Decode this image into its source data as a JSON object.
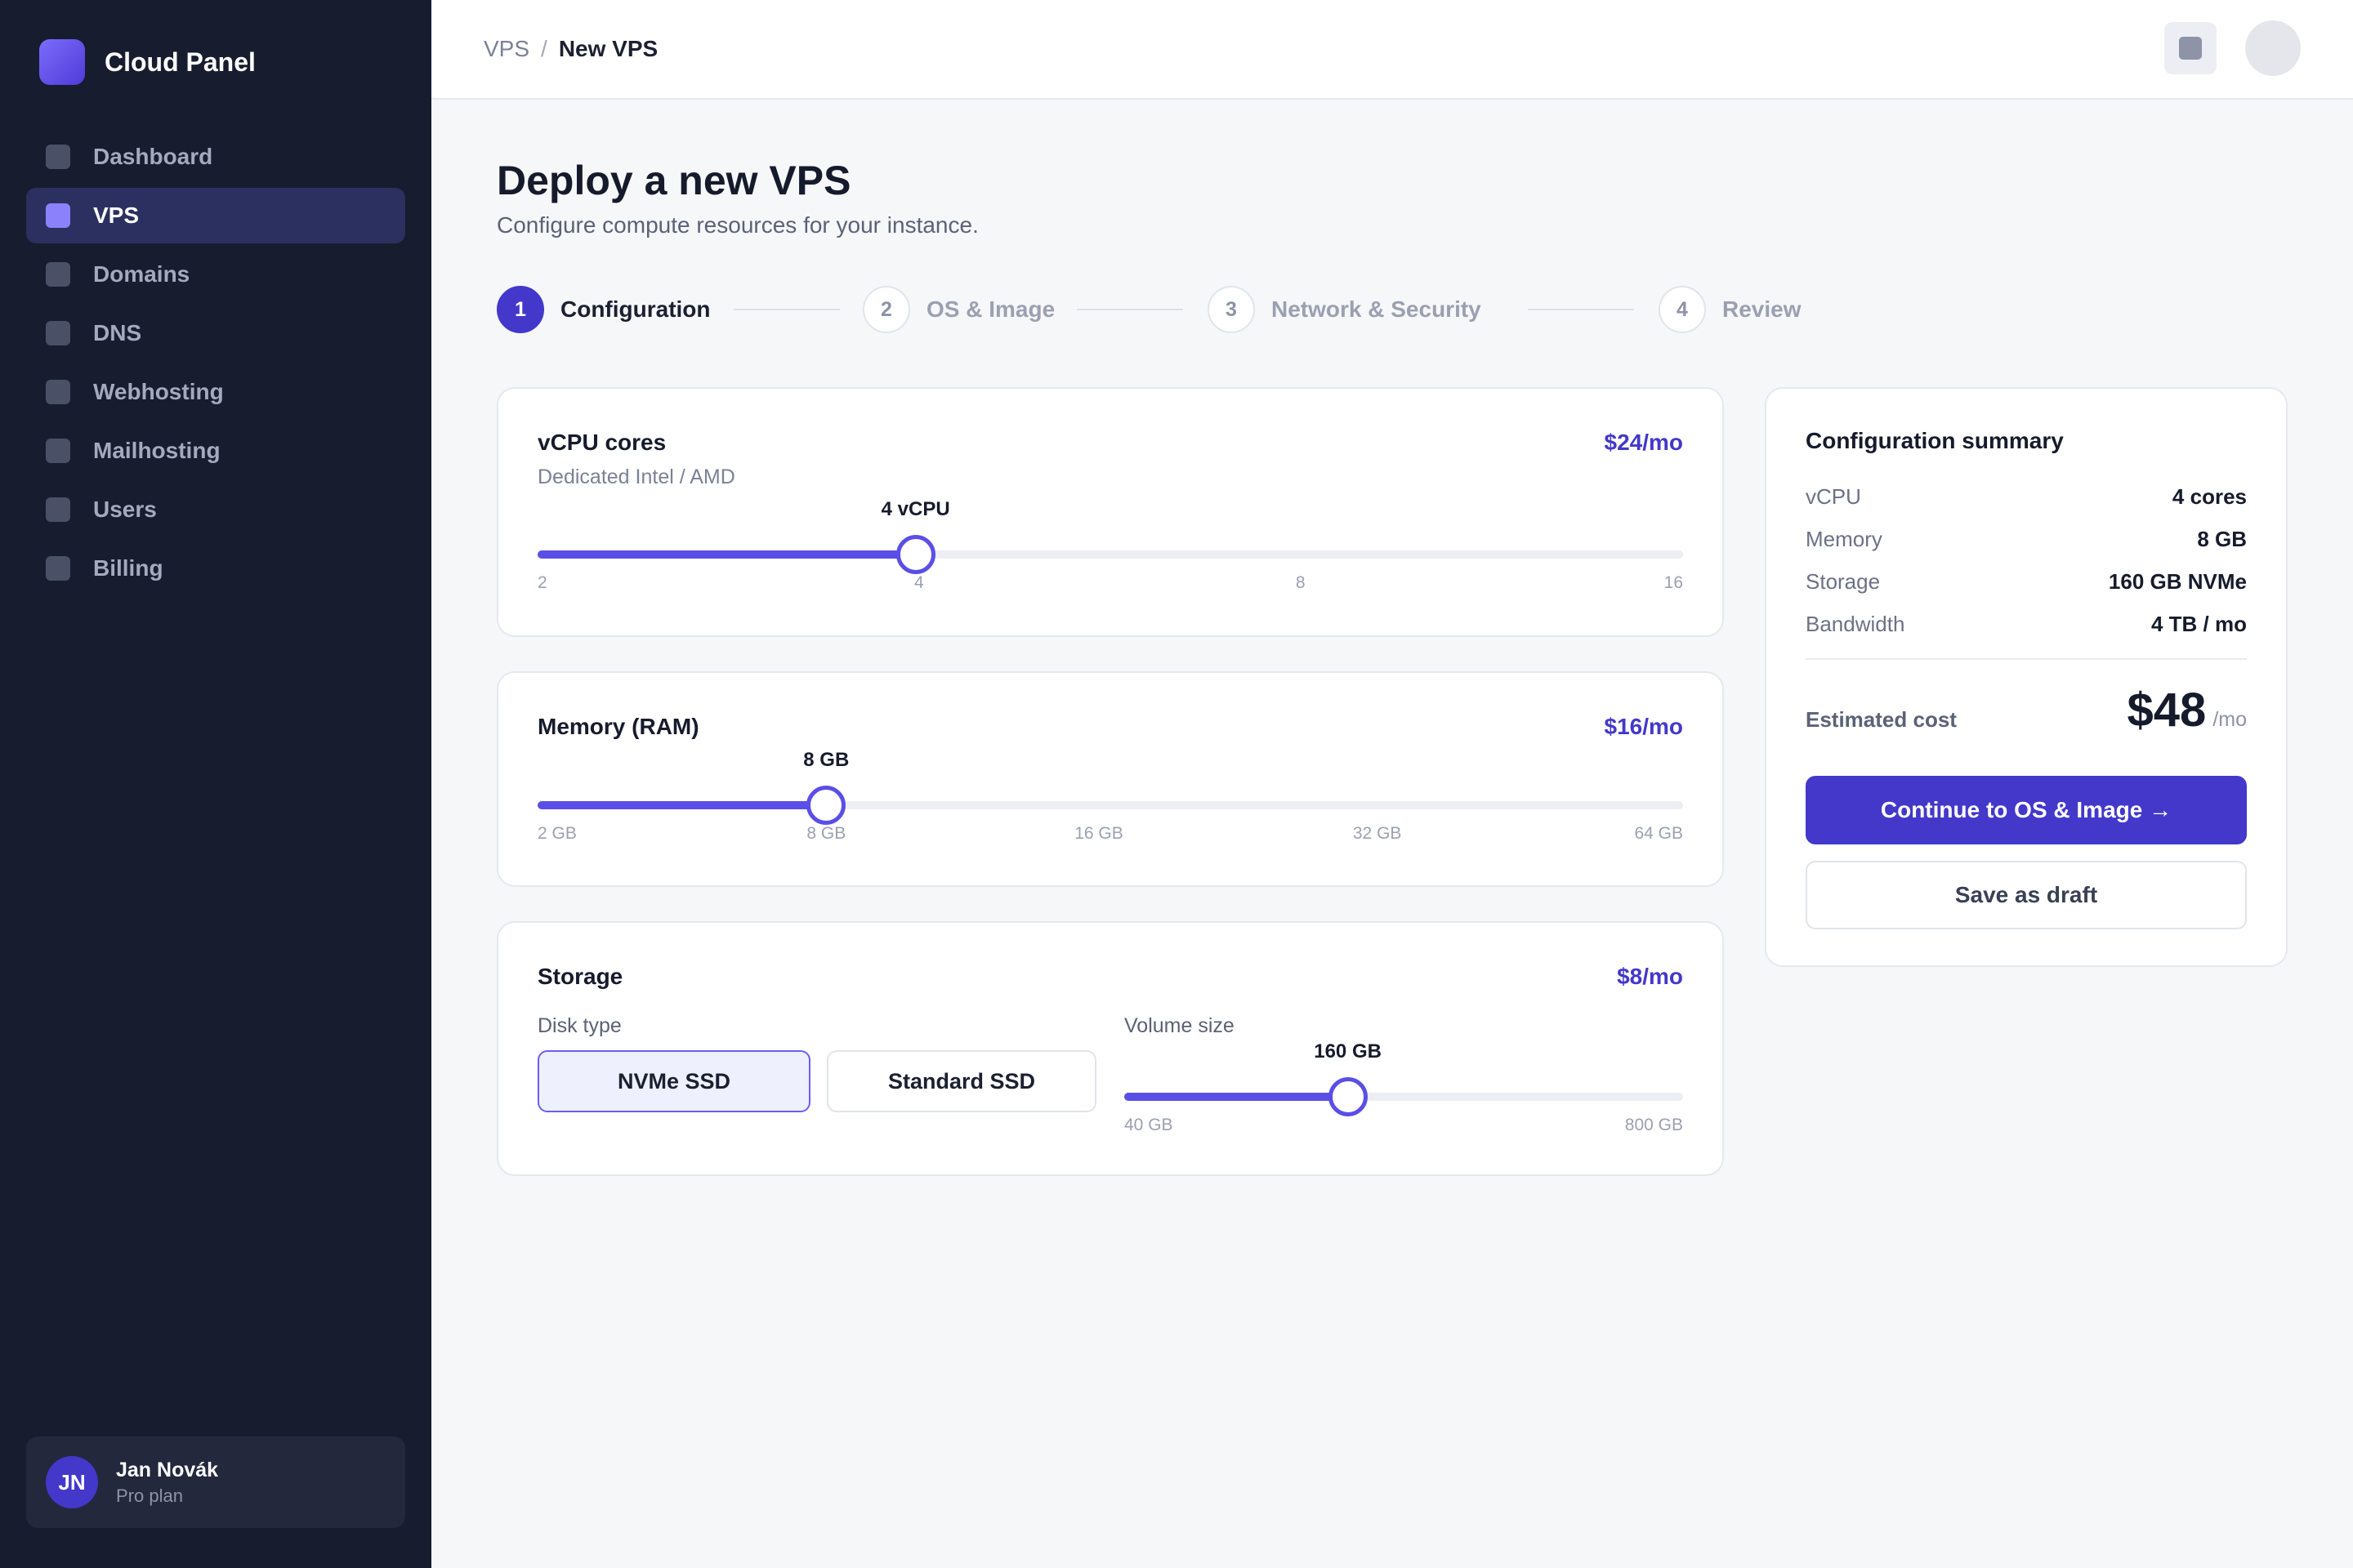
{
  "app": {
    "name": "Cloud Panel"
  },
  "sidebar": {
    "items": [
      {
        "label": "Dashboard",
        "active": false
      },
      {
        "label": "VPS",
        "active": true
      },
      {
        "label": "Domains",
        "active": false
      },
      {
        "label": "DNS",
        "active": false
      },
      {
        "label": "Webhosting",
        "active": false
      },
      {
        "label": "Mailhosting",
        "active": false
      },
      {
        "label": "Users",
        "active": false
      },
      {
        "label": "Billing",
        "active": false
      }
    ],
    "user": {
      "initials": "JN",
      "name": "Jan Novák",
      "plan": "Pro plan"
    }
  },
  "header": {
    "breadcrumb": {
      "root": "VPS",
      "separator": "/",
      "current": "New VPS"
    }
  },
  "page": {
    "title": "Deploy a new VPS",
    "subtitle": "Configure compute resources for your instance."
  },
  "steps": [
    {
      "num": "1",
      "label": "Configuration",
      "active": true
    },
    {
      "num": "2",
      "label": "OS & Image",
      "active": false
    },
    {
      "num": "3",
      "label": "Network & Security",
      "active": false
    },
    {
      "num": "4",
      "label": "Review",
      "active": false
    }
  ],
  "vcpu": {
    "title": "vCPU cores",
    "subtitle": "Dedicated Intel / AMD",
    "price": "$24/mo",
    "value_label": "4 vCPU",
    "ticks": [
      "2",
      "4",
      "8",
      "16"
    ],
    "selected_index": 1
  },
  "memory": {
    "title": "Memory (RAM)",
    "price": "$16/mo",
    "value_label": "8 GB",
    "ticks": [
      "2 GB",
      "8 GB",
      "16 GB",
      "32 GB",
      "64 GB"
    ],
    "selected_index": 1
  },
  "storage": {
    "title": "Storage",
    "price": "$8/mo",
    "disk_type_label": "Disk type",
    "disk_options": [
      "NVMe SSD",
      "Standard SSD"
    ],
    "selected_disk": "NVMe SSD",
    "volume_label": "Volume size",
    "volume_value_label": "160 GB",
    "volume_min": "40 GB",
    "volume_max": "800 GB",
    "volume_fill_fraction": 0.4
  },
  "summary": {
    "title": "Configuration summary",
    "rows": [
      {
        "key": "vCPU",
        "value": "4 cores"
      },
      {
        "key": "Memory",
        "value": "8 GB"
      },
      {
        "key": "Storage",
        "value": "160 GB NVMe"
      },
      {
        "key": "Bandwidth",
        "value": "4 TB / mo"
      }
    ],
    "estimated_label": "Estimated cost",
    "estimated_value": "$48",
    "estimated_unit": "/mo",
    "continue_label": "Continue to OS & Image →",
    "draft_label": "Save as draft"
  },
  "colors": {
    "accent": "#4338ca",
    "slider": "#5b4ee6",
    "sidebar_bg": "#171c2e"
  }
}
